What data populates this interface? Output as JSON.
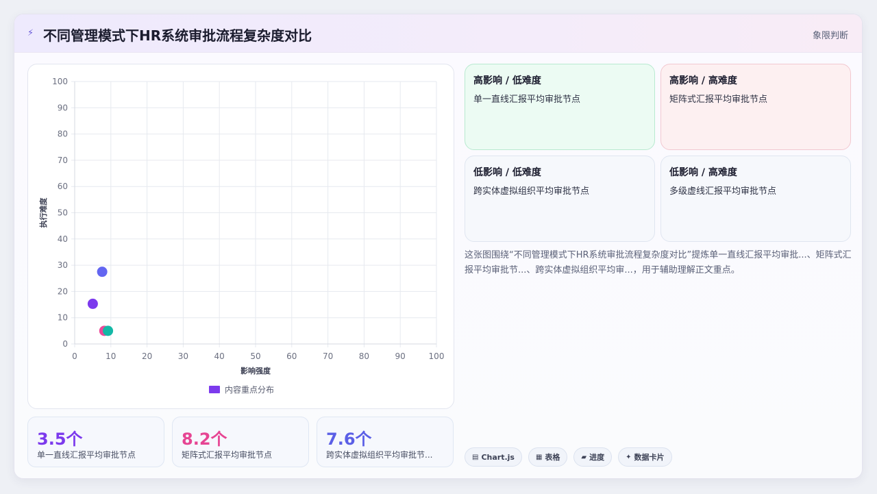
{
  "header": {
    "icon": "lightning-icon",
    "title": "不同管理模式下HR系统审批流程复杂度对比",
    "tag": "象限判断"
  },
  "chart_data": {
    "type": "scatter",
    "xlabel": "影响强度",
    "ylabel": "执行难度",
    "xlim": [
      0,
      100
    ],
    "ylim": [
      0,
      100
    ],
    "x_ticks": [
      0,
      10,
      20,
      30,
      40,
      50,
      60,
      70,
      80,
      90,
      100
    ],
    "y_ticks": [
      0,
      10,
      20,
      30,
      40,
      50,
      60,
      70,
      80,
      90,
      100
    ],
    "grid": true,
    "legend_position": "bottom",
    "series": [
      {
        "name": "内容重点分布",
        "color": "#7c3aed",
        "points": [
          {
            "x": 5.0,
            "y": 15.3,
            "color": "#7c3aed"
          },
          {
            "x": 7.6,
            "y": 27.5,
            "color": "#6366f1"
          },
          {
            "x": 8.2,
            "y": 5.0,
            "color": "#ec4899"
          },
          {
            "x": 9.2,
            "y": 5.0,
            "color": "#14b8a6"
          }
        ]
      }
    ]
  },
  "stats": [
    {
      "value": "3.5个",
      "label": "单一直线汇报平均审批节点",
      "color": "#7c3aed"
    },
    {
      "value": "8.2个",
      "label": "矩阵式汇报平均审批节点",
      "color": "#e64593"
    },
    {
      "value": "7.6个",
      "label": "跨实体虚拟组织平均审批节...",
      "color": "#5b5fe6"
    }
  ],
  "quadrants": [
    {
      "title": "高影响 / 低难度",
      "text": "单一直线汇报平均审批节点",
      "tone": "green"
    },
    {
      "title": "高影响 / 高难度",
      "text": "矩阵式汇报平均审批节点",
      "tone": "pink"
    },
    {
      "title": "低影响 / 低难度",
      "text": "跨实体虚拟组织平均审批节点",
      "tone": "gray"
    },
    {
      "title": "低影响 / 高难度",
      "text": "多级虚线汇报平均审批节点",
      "tone": "gray"
    }
  ],
  "description": "这张图围绕“不同管理模式下HR系统审批流程复杂度对比”提炼单一直线汇报平均审批...、矩阵式汇报平均审批节...、跨实体虚拟组织平均审...，用于辅助理解正文重点。",
  "chips": [
    {
      "icon": "chart-icon",
      "glyph": "▤",
      "label": "Chart.js"
    },
    {
      "icon": "table-icon",
      "glyph": "▦",
      "label": "表格"
    },
    {
      "icon": "progress-icon",
      "glyph": "▰",
      "label": "进度"
    },
    {
      "icon": "sparkle-icon",
      "glyph": "✦",
      "label": "数据卡片"
    }
  ]
}
